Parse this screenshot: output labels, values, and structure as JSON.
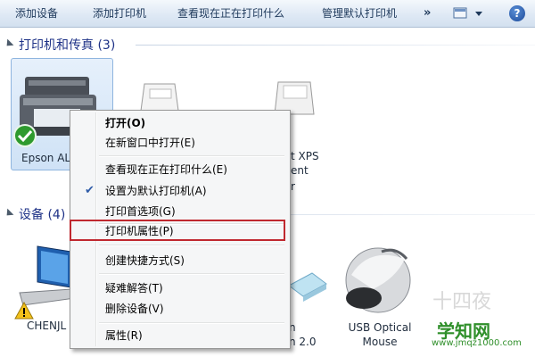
{
  "toolbar": {
    "add_device": "添加设备",
    "add_printer": "添加打印机",
    "see_printing": "查看现在正在打印什么",
    "manage_default": "管理默认打印机",
    "more": "»",
    "help": "?"
  },
  "groups": {
    "printers_title": "打印机和传真 (3)",
    "devices_title": "设备 (4)"
  },
  "printers": [
    {
      "label": "Epson AL"
    },
    {
      "label": ""
    },
    {
      "label_lines": [
        "t XPS",
        "ent",
        "r"
      ]
    }
  ],
  "devices": [
    {
      "label": "CHENJL"
    },
    {
      "label_lines": [
        "n",
        "n 2.0"
      ]
    },
    {
      "label_lines": [
        "USB Optical",
        "Mouse"
      ]
    }
  ],
  "context_menu": {
    "items": [
      "打开(O)",
      "在新窗口中打开(E)",
      "查看现在正在打印什么(E)",
      "设置为默认打印机(A)",
      "打印首选项(G)",
      "打印机属性(P)",
      "创建快捷方式(S)",
      "疑难解答(T)",
      "删除设备(V)",
      "属性(R)"
    ],
    "checked_item": "设置为默认打印机(A)",
    "highlighted_item": "打印机属性(P)"
  },
  "watermark": {
    "logo": "学知网",
    "url": "www.jmqz1000.com",
    "faint": "十四夜"
  },
  "colors": {
    "highlight_border": "#c0282f",
    "check_color": "#2f5ca8",
    "default_badge": "#2e9a2e"
  }
}
